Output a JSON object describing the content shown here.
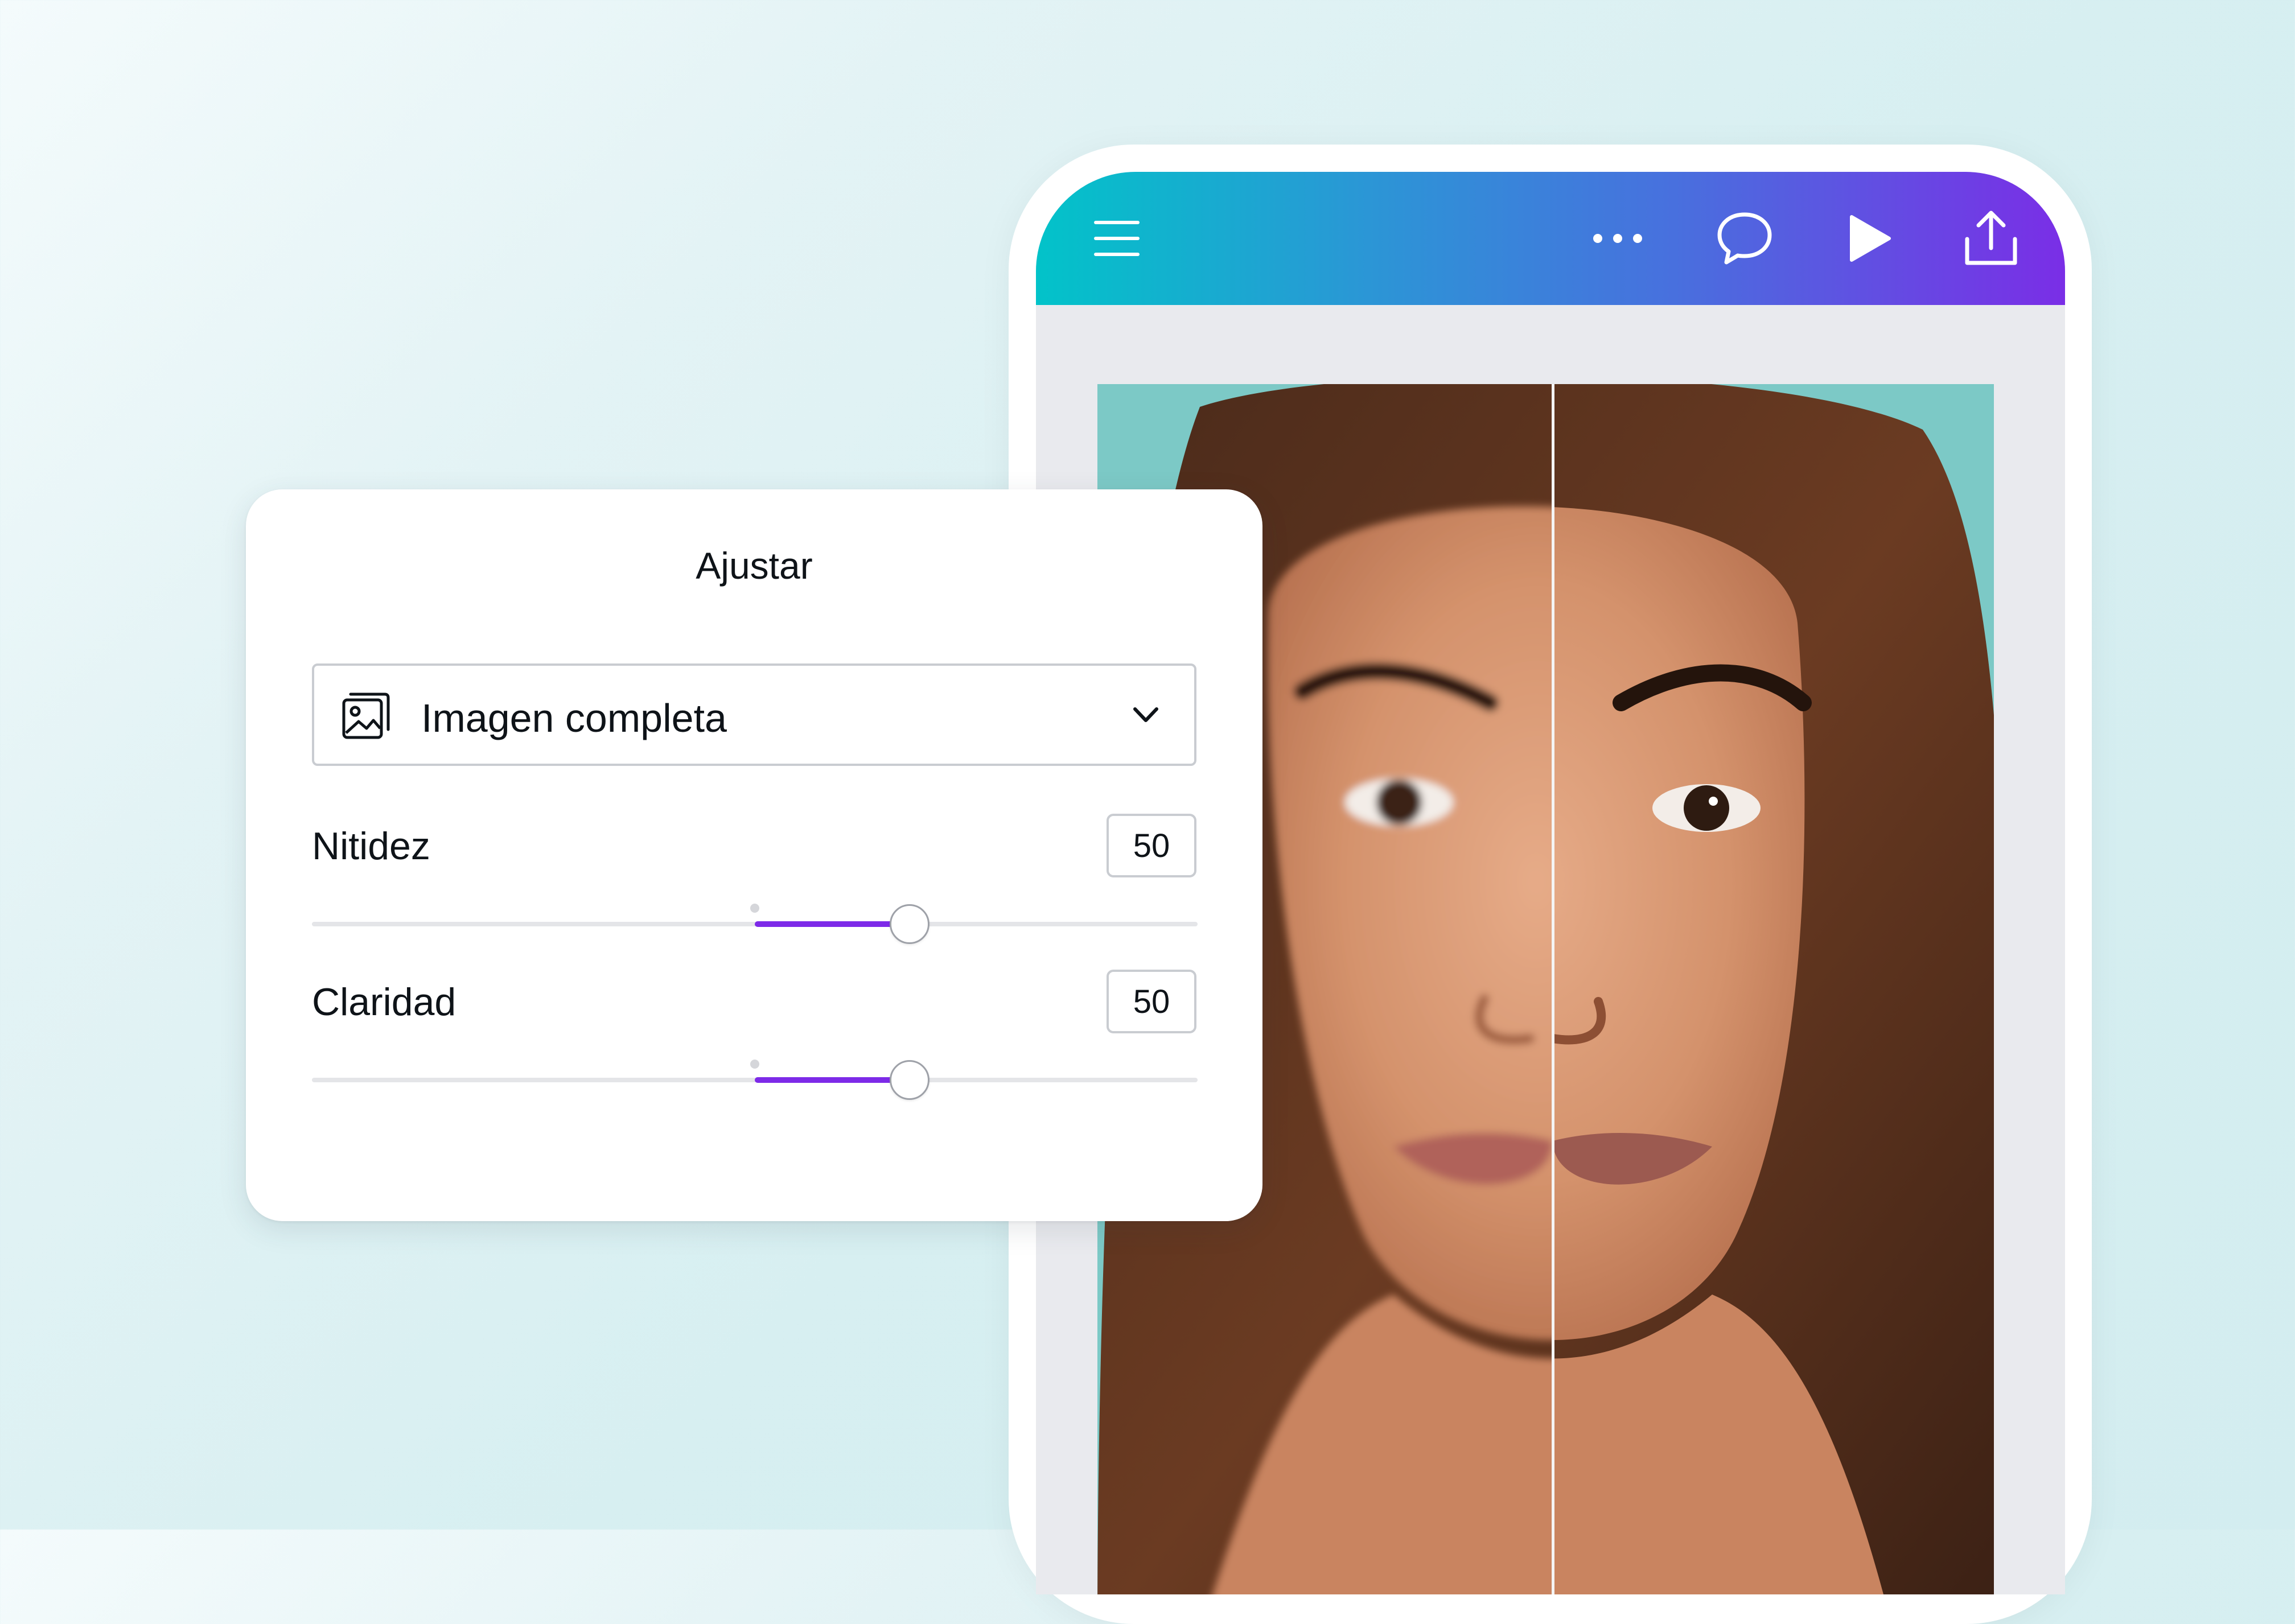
{
  "topbar": {
    "icons": [
      "hamburger-menu-icon",
      "more-options-icon",
      "comment-icon",
      "play-icon",
      "share-upload-icon"
    ],
    "gradient": [
      "#02c3c9",
      "#7a2ee6"
    ]
  },
  "panel": {
    "title": "Ajustar",
    "dropdown": {
      "icon": "image-icon",
      "selected": "Imagen completa"
    },
    "sliders": [
      {
        "label": "Nitidez",
        "value": "50",
        "percent": 50
      },
      {
        "label": "Claridad",
        "value": "50",
        "percent": 50
      }
    ],
    "accent": "#7d2ae8"
  },
  "canvas": {
    "image": "before-after-portrait-photo",
    "background_color": "#7cc9c6"
  }
}
